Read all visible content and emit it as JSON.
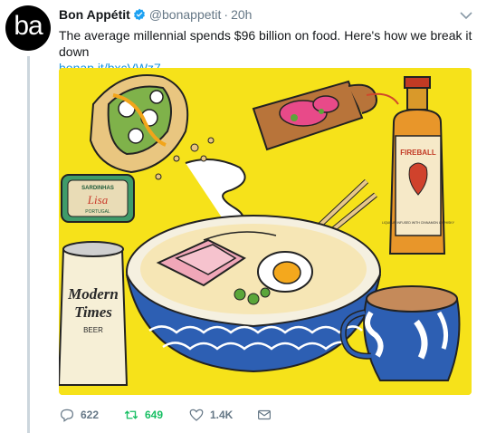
{
  "avatar": {
    "text": "ba"
  },
  "author": {
    "name": "Bon Appétit",
    "handle": "@bonappetit",
    "separator": "·",
    "time": "20h"
  },
  "tweet": {
    "text": "The average millennial spends $96 billion on food. Here's how we break it down",
    "link": "bonap.it/bxcVWz7"
  },
  "media": {
    "labels": {
      "sardines_top": "SARDINHAS",
      "sardines_brand": "Lisa",
      "sardines_bottom": "PORTUGAL",
      "beer_line1": "Modern",
      "beer_line2": "Times",
      "beer_line3": "BEER",
      "whisky_brand": "FIREBALL",
      "whisky_sub": "LIQUEUR INFUSED WITH CINNAMON & WHISKY"
    }
  },
  "actions": {
    "replies": "622",
    "retweets": "649",
    "likes": "1.4K"
  },
  "colors": {
    "link": "#1b95e0",
    "retweet": "#17bf63",
    "muted": "#657786",
    "media_bg": "#f6e21a"
  }
}
